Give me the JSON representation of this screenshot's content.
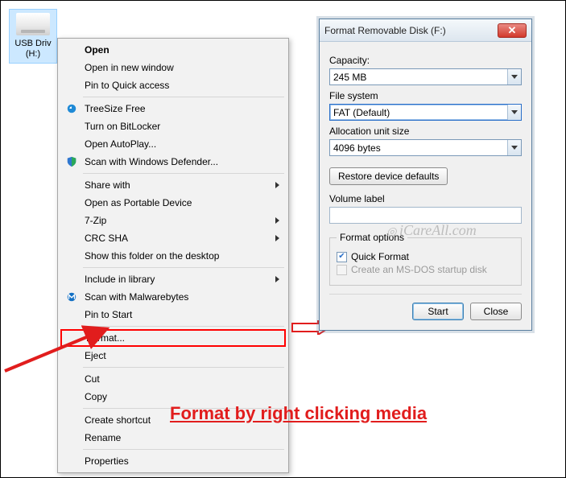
{
  "drive": {
    "line1": "USB Driv",
    "line2": "(H:)"
  },
  "menu": {
    "open": "Open",
    "open_new": "Open in new window",
    "pin_quick": "Pin to Quick access",
    "treesize": "TreeSize Free",
    "bitlocker": "Turn on BitLocker",
    "autoplay": "Open AutoPlay...",
    "defender": "Scan with Windows Defender...",
    "share": "Share with",
    "portable": "Open as Portable Device",
    "sevenzip": "7-Zip",
    "crc": "CRC SHA",
    "showfolder": "Show this folder on the desktop",
    "library": "Include in library",
    "malwarebytes": "Scan with Malwarebytes",
    "pin_start": "Pin to Start",
    "format": "Format...",
    "eject": "Eject",
    "cut": "Cut",
    "copy": "Copy",
    "shortcut": "Create shortcut",
    "rename": "Rename",
    "properties": "Properties"
  },
  "dialog": {
    "title": "Format Removable Disk (F:)",
    "capacity_label": "Capacity:",
    "capacity_value": "245 MB",
    "filesystem_label": "File system",
    "filesystem_value": "FAT (Default)",
    "alloc_label": "Allocation unit size",
    "alloc_value": "4096 bytes",
    "restore": "Restore device defaults",
    "volume_label": "Volume label",
    "volume_value": "",
    "format_options": "Format options",
    "quick_format": "Quick Format",
    "msdos": "Create an MS-DOS startup disk",
    "start": "Start",
    "close": "Close"
  },
  "watermark": "iCareAll.com",
  "caption": "Format by right clicking media"
}
